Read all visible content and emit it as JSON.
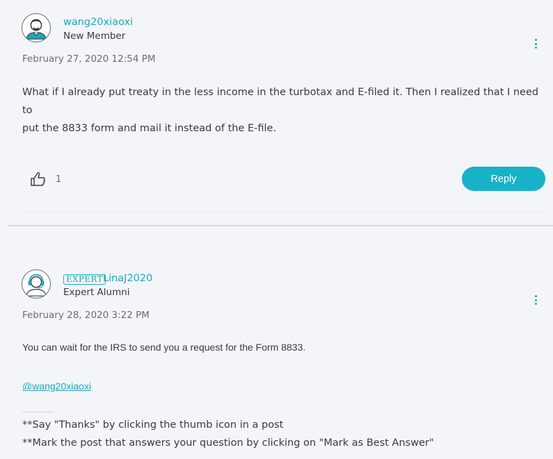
{
  "post1": {
    "username": "wang20xiaoxi",
    "rank": "New Member",
    "date": "February 27, 2020 12:54 PM",
    "body_line1": "What if I already put treaty in the less income in the turbotax and E-filed it. Then I realized that I need to",
    "body_line2": "put the 8833 form and mail it instead of the E-file.",
    "kudos_count": "1",
    "reply_label": "Reply",
    "icons": {
      "avatar": "user-avatar-icon",
      "menu": "kebab-menu-icon",
      "kudo": "thumbs-up-icon"
    }
  },
  "post2": {
    "badge": "EXPERT",
    "username": "LinaJ2020",
    "rank": "Expert Alumni",
    "date": "February 28, 2020 3:22 PM",
    "answer": "You can wait for the IRS to send you a request for the Form 8833.",
    "mention": "@wang20xiaoxi",
    "tip1": "**Say \"Thanks\" by clicking the thumb icon in a post",
    "tip2": "**Mark the post that answers your question by clicking on \"Mark as Best Answer\"",
    "icons": {
      "avatar": "expert-headset-avatar-icon",
      "menu": "kebab-menu-icon"
    }
  },
  "colors": {
    "accent": "#1ba9bd",
    "button": "#18b2c8",
    "background": "#f4f5f8",
    "text": "#393a3d"
  }
}
